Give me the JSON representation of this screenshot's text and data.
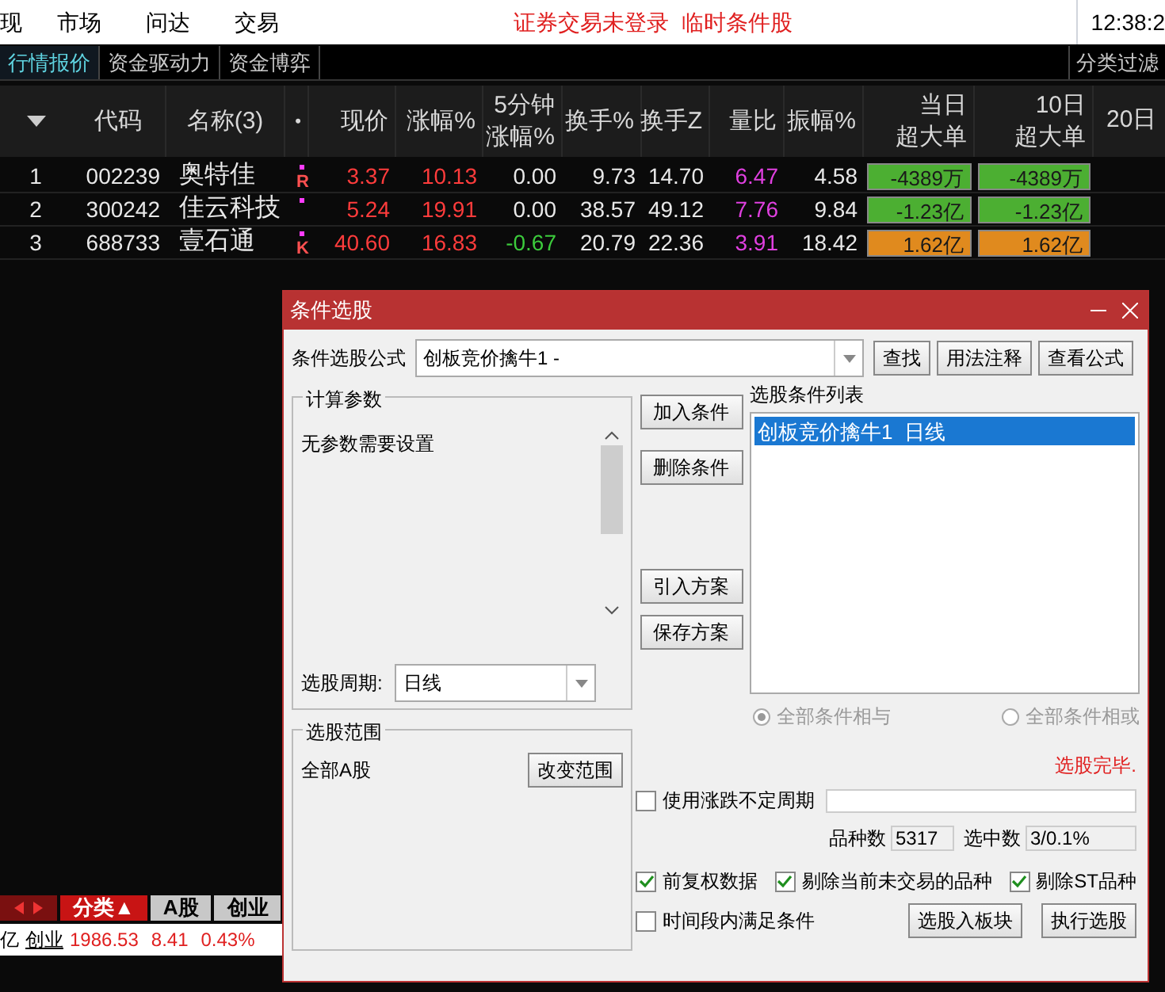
{
  "menu": {
    "items": [
      "现",
      "市场",
      "问达",
      "交易"
    ],
    "notice": "证券交易未登录  临时条件股",
    "time": "12:38:2"
  },
  "tabs": [
    {
      "label": "行情报价",
      "selected": true
    },
    {
      "label": "资金驱动力",
      "selected": false
    },
    {
      "label": "资金博弈",
      "selected": false
    }
  ],
  "filter": "分类过滤",
  "table": {
    "columns": [
      {
        "lines": [
          "代码"
        ]
      },
      {
        "lines": [
          "名称(3)"
        ]
      },
      {
        "lines": [
          "•"
        ]
      },
      {
        "lines": [
          "现价"
        ]
      },
      {
        "lines": [
          "涨幅%"
        ]
      },
      {
        "lines": [
          "5分钟",
          "涨幅%"
        ]
      },
      {
        "lines": [
          "换手%"
        ]
      },
      {
        "lines": [
          "换手Z"
        ]
      },
      {
        "lines": [
          "量比"
        ]
      },
      {
        "lines": [
          "振幅%"
        ]
      },
      {
        "lines": [
          "当日",
          "超大单"
        ]
      },
      {
        "lines": [
          "10日",
          "超大单"
        ]
      },
      {
        "lines": [
          "20日"
        ]
      }
    ],
    "rows": [
      {
        "index": "1",
        "code": "002239",
        "name": "奥特佳",
        "mark": "R",
        "price": "3.37",
        "change": "10.13",
        "change_5min": {
          "text": "0.00",
          "color": "#e8e8e8"
        },
        "turnover": "9.73",
        "turnover_z": "14.70",
        "volume_ratio": "6.47",
        "amplitude": "4.58",
        "today_big": {
          "text": "-4389万",
          "color": "#4caf32"
        },
        "ten_day_big": {
          "text": "-4389万",
          "color": "#4caf32"
        }
      },
      {
        "index": "2",
        "code": "300242",
        "name": "佳云科技",
        "mark": "",
        "price": "5.24",
        "change": "19.91",
        "change_5min": {
          "text": "0.00",
          "color": "#e8e8e8"
        },
        "turnover": "38.57",
        "turnover_z": "49.12",
        "volume_ratio": "7.76",
        "amplitude": "9.84",
        "today_big": {
          "text": "-1.23亿",
          "color": "#4caf32"
        },
        "ten_day_big": {
          "text": "-1.23亿",
          "color": "#4caf32"
        }
      },
      {
        "index": "3",
        "code": "688733",
        "name": "壹石通",
        "mark": "K",
        "price": "40.60",
        "change": "16.83",
        "change_5min": {
          "text": "-0.67",
          "color": "#3ccb3c"
        },
        "turnover": "20.79",
        "turnover_z": "22.36",
        "volume_ratio": "3.91",
        "amplitude": "18.42",
        "today_big": {
          "text": "1.62亿",
          "color": "#e08a1e"
        },
        "ten_day_big": {
          "text": "1.62亿",
          "color": "#e08a1e"
        }
      }
    ]
  },
  "bottom_tabs": [
    {
      "label": "分类▲",
      "selected": true
    },
    {
      "label": "A股",
      "selected": false
    },
    {
      "label": "创业",
      "selected": false
    }
  ],
  "index_line": {
    "label": "亿",
    "name": "创业",
    "value": "1986.53",
    "change": "8.41",
    "percent": "0.43%"
  },
  "dialog": {
    "title": "条件选股",
    "formula_label": "条件选股公式",
    "formula": "创板竞价擒牛1 -",
    "buttons_top": [
      "查找",
      "用法注释",
      "查看公式"
    ],
    "params_group": "计算参数",
    "params_text": "无参数需要设置",
    "period_label": "选股周期:",
    "period": "日线",
    "middle_buttons": [
      "加入条件",
      "删除条件",
      "引入方案",
      "保存方案"
    ],
    "list_label": "选股条件列表",
    "conditions": [
      {
        "text": "创板竞价擒牛1  日线",
        "selected": true
      }
    ],
    "logic": [
      {
        "label": "全部条件相与",
        "selected": true
      },
      {
        "label": "全部条件相或",
        "selected": false
      }
    ],
    "range_group": "选股范围",
    "range": "全部A股",
    "range_button": "改变范围",
    "status": "选股完毕.",
    "options": [
      {
        "label": "使用涨跌不定周期",
        "checked": false
      },
      {
        "label": "前复权数据",
        "checked": true
      },
      {
        "label": "剔除当前未交易的品种",
        "checked": true
      },
      {
        "label": "剔除ST品种",
        "checked": true
      },
      {
        "label": "时间段内满足条件",
        "checked": false
      }
    ],
    "count_label": "品种数",
    "count": "5317",
    "selected_label": "选中数",
    "selected_count": "3/0.1%",
    "action_buttons": [
      "选股入板块",
      "执行选股"
    ]
  }
}
